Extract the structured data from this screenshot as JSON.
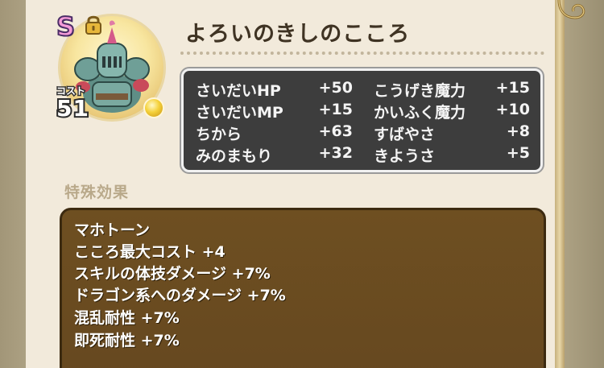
{
  "monster": {
    "rank": "S",
    "cost_label": "コスト",
    "cost_value": "51",
    "name": "よろいのきしのこころ",
    "icons": [
      "lock-icon",
      "armored-knight-portrait",
      "gold-coin-icon"
    ]
  },
  "stats": {
    "left": [
      {
        "label": "さいだいHP",
        "value": "+50"
      },
      {
        "label": "さいだいMP",
        "value": "+15"
      },
      {
        "label": "ちから",
        "value": "+63"
      },
      {
        "label": "みのまもり",
        "value": "+32"
      }
    ],
    "right": [
      {
        "label": "こうげき魔力",
        "value": "+15"
      },
      {
        "label": "かいふく魔力",
        "value": "+10"
      },
      {
        "label": "すばやさ",
        "value": "+8"
      },
      {
        "label": "きようさ",
        "value": "+5"
      }
    ]
  },
  "special": {
    "heading": "特殊効果",
    "effects": [
      "マホトーン",
      "こころ最大コスト +4",
      "スキルの体技ダメージ +7%",
      "ドラゴン系へのダメージ +7%",
      "混乱耐性 +7%",
      "即死耐性 +7%"
    ]
  },
  "colors": {
    "panel_bg": "#f2eadb",
    "stats_bg": "#3d3d3d",
    "effects_bg": "#6e4f21",
    "title_text": "#3f3323",
    "rank_pink": "#f49bd8"
  }
}
